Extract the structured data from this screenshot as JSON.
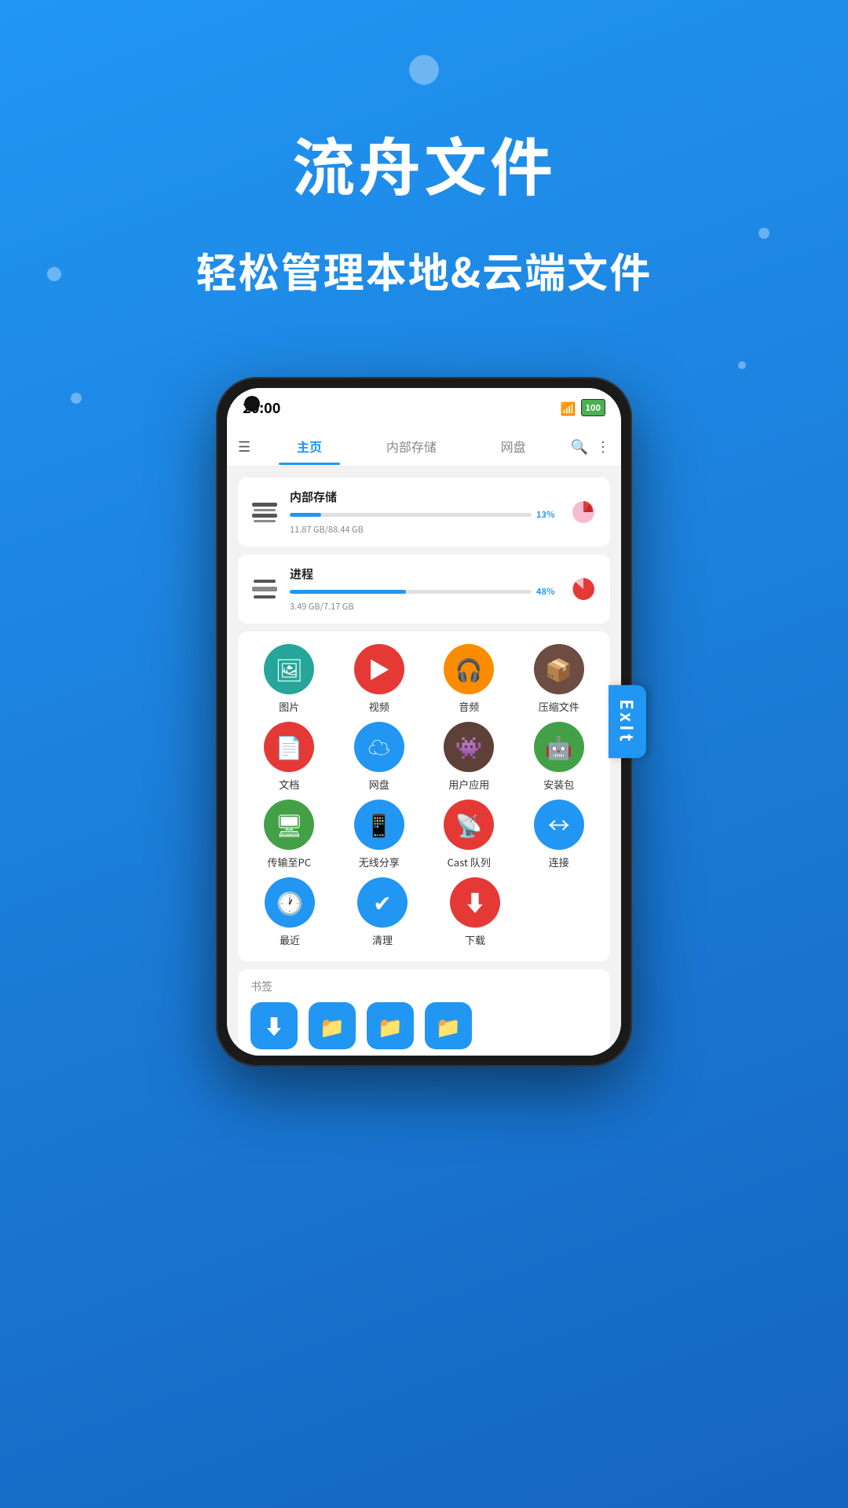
{
  "background": {
    "gradient_start": "#2196F3",
    "gradient_end": "#1565C0"
  },
  "header": {
    "app_title": "流舟文件",
    "app_subtitle": "轻松管理本地&云端文件"
  },
  "phone": {
    "status_bar": {
      "time": "20:00",
      "wifi_icon": "📶",
      "battery_label": "100"
    },
    "nav": {
      "menu_icon": "☰",
      "tabs": [
        {
          "id": "home",
          "label": "主页",
          "active": true
        },
        {
          "id": "internal",
          "label": "内部存储",
          "active": false
        },
        {
          "id": "cloud",
          "label": "网盘",
          "active": false
        }
      ],
      "search_icon": "🔍",
      "more_icon": "⋮"
    },
    "storage_cards": [
      {
        "id": "internal-storage",
        "name": "内部存储",
        "percent": 13,
        "percent_label": "13%",
        "size_label": "11.87 GB/88.44 GB",
        "bar_color": "#2196F3",
        "pie_color": "#e53935"
      },
      {
        "id": "process",
        "name": "进程",
        "percent": 48,
        "percent_label": "48%",
        "size_label": "3.49 GB/7.17 GB",
        "bar_color": "#2196F3",
        "pie_color": "#e53935"
      }
    ],
    "grid_items": [
      {
        "id": "photos",
        "label": "图片",
        "icon": "🖼",
        "color": "#26A69A"
      },
      {
        "id": "video",
        "label": "视频",
        "icon": "▶",
        "color": "#e53935"
      },
      {
        "id": "audio",
        "label": "音频",
        "icon": "🎧",
        "color": "#FB8C00"
      },
      {
        "id": "archive",
        "label": "压缩文件",
        "icon": "📦",
        "color": "#6D4C41"
      },
      {
        "id": "docs",
        "label": "文档",
        "icon": "📄",
        "color": "#e53935"
      },
      {
        "id": "cloud",
        "label": "网盘",
        "icon": "☁",
        "color": "#2196F3"
      },
      {
        "id": "apps",
        "label": "用户应用",
        "icon": "👾",
        "color": "#5D4037"
      },
      {
        "id": "apk",
        "label": "安装包",
        "icon": "🤖",
        "color": "#43A047"
      },
      {
        "id": "transfer-pc",
        "label": "传输至PC",
        "icon": "🖥",
        "color": "#43A047"
      },
      {
        "id": "wireless",
        "label": "无线分享",
        "icon": "📱",
        "color": "#2196F3"
      },
      {
        "id": "cast",
        "label": "Cast 队列",
        "icon": "📡",
        "color": "#e53935"
      },
      {
        "id": "connect",
        "label": "连接",
        "icon": "↔",
        "color": "#2196F3"
      },
      {
        "id": "recent",
        "label": "最近",
        "icon": "🕐",
        "color": "#2196F3"
      },
      {
        "id": "clean",
        "label": "清理",
        "icon": "✔",
        "color": "#2196F3"
      },
      {
        "id": "download",
        "label": "下载",
        "icon": "⬇",
        "color": "#e53935"
      }
    ],
    "bookmarks": {
      "title": "书签",
      "items": [
        {
          "id": "bm1",
          "icon": "⬇",
          "color": "#2196F3"
        },
        {
          "id": "bm2",
          "icon": "📁",
          "color": "#2196F3"
        },
        {
          "id": "bm3",
          "icon": "📁",
          "color": "#2196F3"
        },
        {
          "id": "bm4",
          "icon": "📁",
          "color": "#2196F3"
        }
      ]
    }
  },
  "exit_button": {
    "label": "ExIt"
  }
}
